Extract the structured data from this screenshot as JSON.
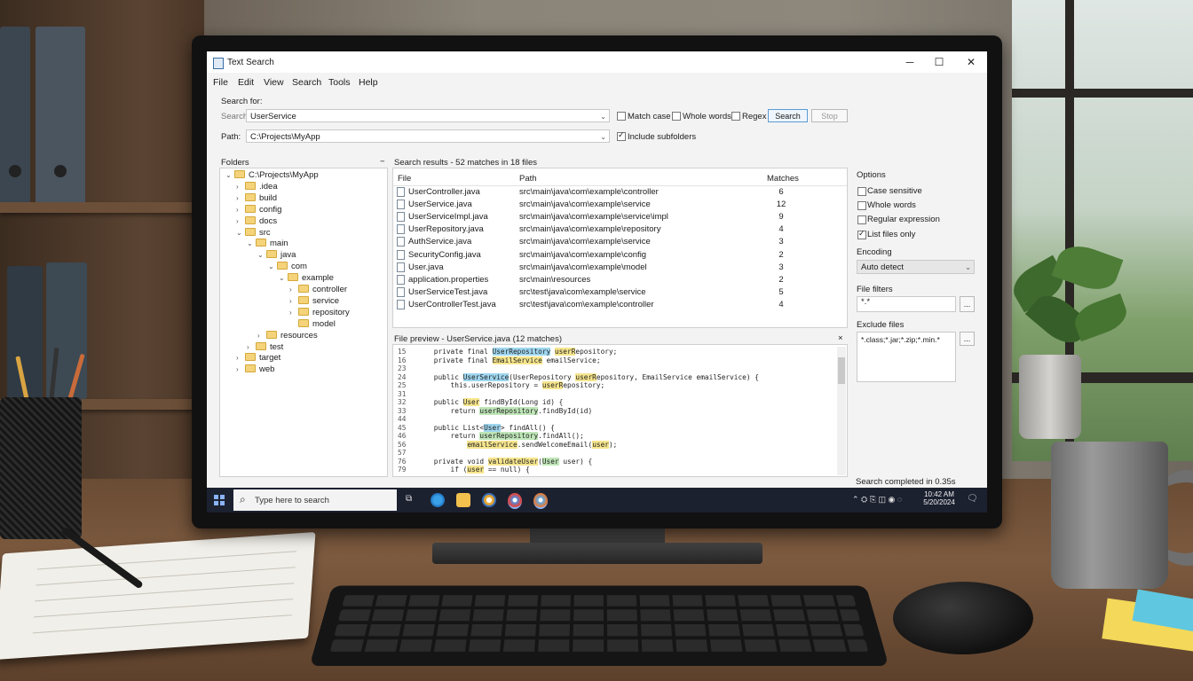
{
  "window": {
    "title": "Text Search",
    "minimize": "─",
    "maximize": "☐",
    "close": "✕"
  },
  "menu": [
    "File",
    "Edit",
    "View",
    "Search",
    "Tools",
    "Help"
  ],
  "search_panel": {
    "section_title": "Search for:",
    "search_label": "Search:",
    "search_value": "UserService",
    "path_label": "Path:",
    "path_value": "C:\\Projects\\MyApp",
    "match_case": "Match case",
    "whole_words": "Whole words",
    "regex": "Regex",
    "search_button": "Search",
    "stop_button": "Stop",
    "include_subfolders": "Include subfolders",
    "include_subfolders_checked": true
  },
  "folders": {
    "title": "Folders",
    "collapse": "−",
    "tree": [
      {
        "label": "C:\\Projects\\MyApp",
        "depth": 0,
        "chev": "⌄"
      },
      {
        "label": ".idea",
        "depth": 1,
        "chev": "›"
      },
      {
        "label": "build",
        "depth": 1,
        "chev": "›"
      },
      {
        "label": "config",
        "depth": 1,
        "chev": "›"
      },
      {
        "label": "docs",
        "depth": 1,
        "chev": "›"
      },
      {
        "label": "src",
        "depth": 1,
        "chev": "⌄"
      },
      {
        "label": "main",
        "depth": 2,
        "chev": "⌄"
      },
      {
        "label": "java",
        "depth": 3,
        "chev": "⌄"
      },
      {
        "label": "com",
        "depth": 4,
        "chev": "⌄"
      },
      {
        "label": "example",
        "depth": 5,
        "chev": "⌄"
      },
      {
        "label": "controller",
        "depth": 6,
        "chev": "›"
      },
      {
        "label": "service",
        "depth": 6,
        "chev": "›"
      },
      {
        "label": "repository",
        "depth": 6,
        "chev": "›"
      },
      {
        "label": "model",
        "depth": 6,
        "chev": ""
      },
      {
        "label": "resources",
        "depth": 3,
        "chev": "›"
      },
      {
        "label": "test",
        "depth": 2,
        "chev": "›"
      },
      {
        "label": "target",
        "depth": 1,
        "chev": "›"
      },
      {
        "label": "web",
        "depth": 1,
        "chev": "›"
      }
    ]
  },
  "results": {
    "title": "Search results - 52 matches in 18 files",
    "columns": [
      "File",
      "Path",
      "Matches"
    ],
    "rows": [
      {
        "file": "UserController.java",
        "path": "src\\main\\java\\com\\example\\controller",
        "matches": "6"
      },
      {
        "file": "UserService.java",
        "path": "src\\main\\java\\com\\example\\service",
        "matches": "12"
      },
      {
        "file": "UserServiceImpl.java",
        "path": "src\\main\\java\\com\\example\\service\\impl",
        "matches": "9"
      },
      {
        "file": "UserRepository.java",
        "path": "src\\main\\java\\com\\example\\repository",
        "matches": "4"
      },
      {
        "file": "AuthService.java",
        "path": "src\\main\\java\\com\\example\\service",
        "matches": "3"
      },
      {
        "file": "SecurityConfig.java",
        "path": "src\\main\\java\\com\\example\\config",
        "matches": "2"
      },
      {
        "file": "User.java",
        "path": "src\\main\\java\\com\\example\\model",
        "matches": "3"
      },
      {
        "file": "application.properties",
        "path": "src\\main\\resources",
        "matches": "2"
      },
      {
        "file": "UserServiceTest.java",
        "path": "src\\test\\java\\com\\example\\service",
        "matches": "5"
      },
      {
        "file": "UserControllerTest.java",
        "path": "src\\test\\java\\com\\example\\controller",
        "matches": "4"
      }
    ]
  },
  "preview": {
    "title": "File preview - UserService.java (12 matches)",
    "close": "×",
    "lines": [
      {
        "n": "15",
        "parts": [
          [
            "    private final ",
            ""
          ],
          [
            "UserRepository",
            "b"
          ],
          [
            " ",
            ""
          ],
          [
            "userR",
            "y"
          ],
          [
            "epository;",
            ""
          ]
        ]
      },
      {
        "n": "16",
        "parts": [
          [
            "    private final ",
            ""
          ],
          [
            "EmailService",
            "y"
          ],
          [
            " emailService;",
            ""
          ]
        ]
      },
      {
        "n": "23",
        "parts": [
          [
            "",
            ""
          ]
        ]
      },
      {
        "n": "24",
        "parts": [
          [
            "    public ",
            ""
          ],
          [
            "UserService",
            "b"
          ],
          [
            "(UserRepository ",
            ""
          ],
          [
            "userR",
            "y"
          ],
          [
            "epository, EmailService emailService) {",
            ""
          ]
        ]
      },
      {
        "n": "25",
        "parts": [
          [
            "        this.userRepository = ",
            ""
          ],
          [
            "userR",
            "y"
          ],
          [
            "epository;",
            ""
          ]
        ]
      },
      {
        "n": "31",
        "parts": [
          [
            "",
            ""
          ]
        ]
      },
      {
        "n": "32",
        "parts": [
          [
            "    public ",
            ""
          ],
          [
            "User",
            "y"
          ],
          [
            " findById(Long id) {",
            ""
          ]
        ]
      },
      {
        "n": "33",
        "parts": [
          [
            "        return ",
            ""
          ],
          [
            "userRepository",
            "g"
          ],
          [
            ".findById(id)",
            ""
          ]
        ]
      },
      {
        "n": "44",
        "parts": [
          [
            "",
            ""
          ]
        ]
      },
      {
        "n": "45",
        "parts": [
          [
            "    public List<",
            ""
          ],
          [
            "User",
            "b"
          ],
          [
            "> findAll() {",
            ""
          ]
        ]
      },
      {
        "n": "46",
        "parts": [
          [
            "        return ",
            ""
          ],
          [
            "userRepository",
            "g"
          ],
          [
            ".findAll();",
            ""
          ]
        ]
      },
      {
        "n": "56",
        "parts": [
          [
            "            ",
            ""
          ],
          [
            "emailService",
            "y"
          ],
          [
            ".sendWelcomeEmail(",
            ""
          ],
          [
            "user",
            "y"
          ],
          [
            ");",
            ""
          ]
        ]
      },
      {
        "n": "57",
        "parts": [
          [
            "",
            ""
          ]
        ]
      },
      {
        "n": "76",
        "parts": [
          [
            "    private void ",
            ""
          ],
          [
            "validateUser",
            "y"
          ],
          [
            "(",
            ""
          ],
          [
            "User",
            "g"
          ],
          [
            " user) {",
            ""
          ]
        ]
      },
      {
        "n": "79",
        "parts": [
          [
            "        if (",
            ""
          ],
          [
            "user",
            "y"
          ],
          [
            " == null) {",
            ""
          ]
        ]
      }
    ]
  },
  "options": {
    "title": "Options",
    "items": [
      {
        "label": "Case sensitive",
        "checked": false
      },
      {
        "label": "Whole words",
        "checked": false
      },
      {
        "label": "Regular expression",
        "checked": false
      },
      {
        "label": "List files only",
        "checked": true
      }
    ],
    "encoding_label": "Encoding",
    "encoding_value": "Auto detect",
    "file_filters_label": "File filters",
    "file_filters_value": "*.*",
    "exclude_label": "Exclude files",
    "exclude_value": "*.class;*.jar;*.zip;*.min.*",
    "browse": "..."
  },
  "status": {
    "text": "Search completed in 0.35s"
  },
  "taskbar": {
    "search_placeholder": "Type here to search",
    "time": "10:42 AM",
    "date": "5/20/2024",
    "tray": "⌃ ⛭ ⎘ ◫ ◉ ◌"
  },
  "colors": {
    "accent": "#5b9bd5",
    "highlight_blue": "#9ed6ef",
    "highlight_yellow": "#f6e58d",
    "highlight_green": "#bfe6b8",
    "taskbar": "#1c2130"
  }
}
